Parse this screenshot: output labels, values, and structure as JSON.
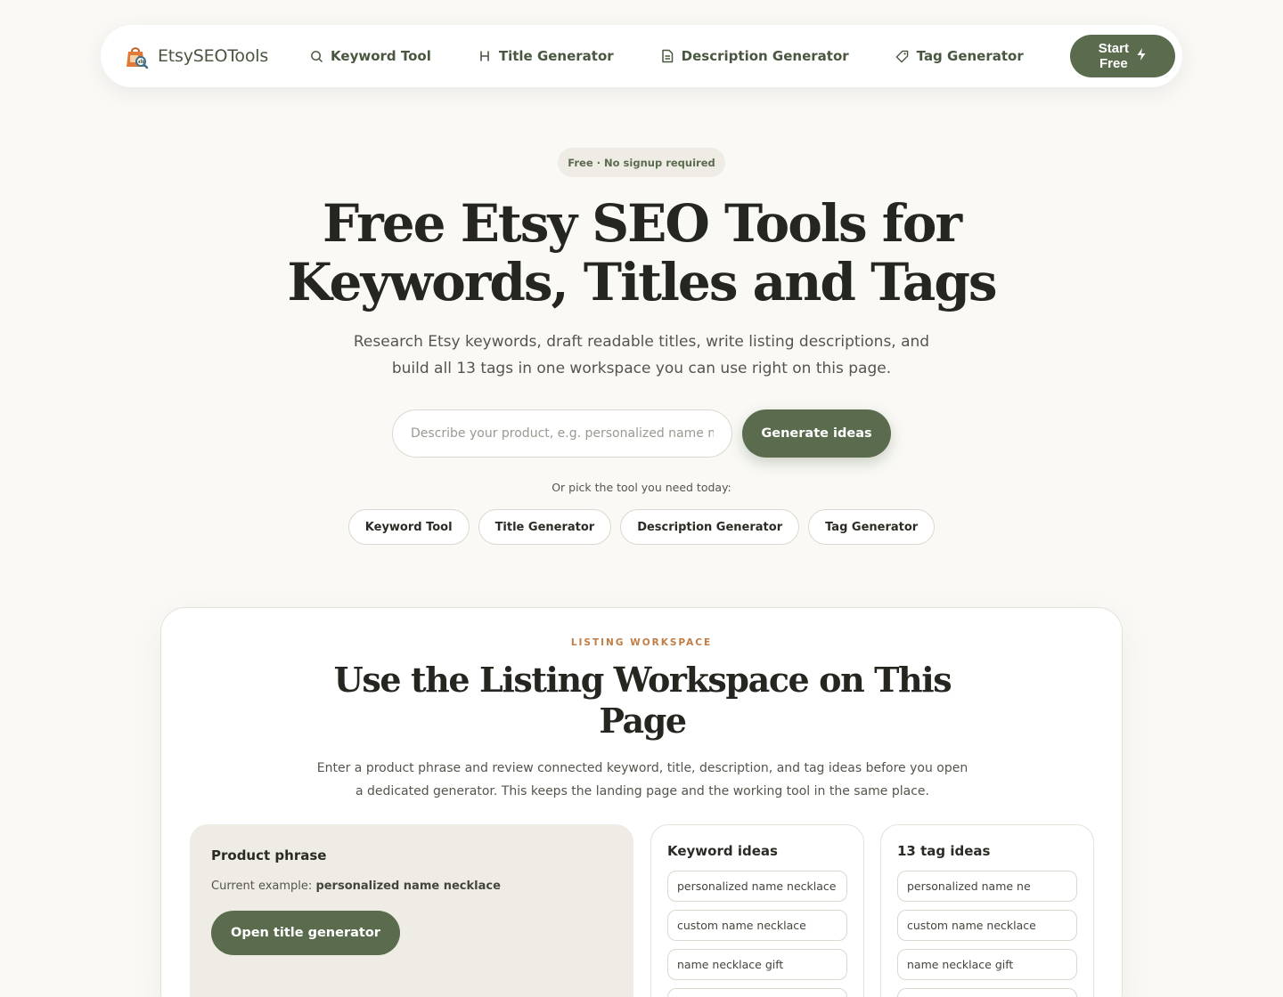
{
  "nav": {
    "brand": "EtsySEOTools",
    "links": [
      {
        "label": "Keyword Tool",
        "icon": "search-icon"
      },
      {
        "label": "Title Generator",
        "icon": "heading-icon"
      },
      {
        "label": "Description Generator",
        "icon": "document-icon"
      },
      {
        "label": "Tag Generator",
        "icon": "tag-icon"
      }
    ],
    "cta": "Start Free"
  },
  "hero": {
    "badge": "Free · No signup required",
    "title_line1": "Free Etsy SEO Tools for",
    "title_line2": "Keywords, Titles and Tags",
    "subtitle_line1": "Research Etsy keywords, draft readable titles, write listing descriptions, and",
    "subtitle_line2": "build all 13 tags in one workspace you can use right on this page.",
    "search_placeholder": "Describe your product, e.g. personalized name necklace",
    "generate_label": "Generate ideas",
    "pick_label": "Or pick the tool you need today:",
    "chips": [
      "Keyword Tool",
      "Title Generator",
      "Description Generator",
      "Tag Generator"
    ]
  },
  "workspace": {
    "eyebrow": "LISTING WORKSPACE",
    "title_line1": "Use the Listing Workspace on This",
    "title_line2": "Page",
    "subtitle_line1": "Enter a product phrase and review connected keyword, title, description, and tag ideas before you open",
    "subtitle_line2": "a dedicated generator. This keeps the landing page and the working tool in the same place.",
    "phrase": {
      "heading": "Product phrase",
      "current_prefix": "Current example:",
      "current_value": "personalized name necklace",
      "button": "Open title generator"
    },
    "keywords": {
      "heading": "Keyword ideas",
      "items": [
        "personalized name necklace",
        "custom name necklace",
        "name necklace gift",
        ""
      ]
    },
    "tags": {
      "heading": "13 tag ideas",
      "items": [
        "personalized name ne",
        "custom name necklace",
        "name necklace gift",
        ""
      ]
    }
  },
  "colors": {
    "accent": "#5b6b4e",
    "eyebrow": "#c07d45",
    "background": "#faf9f6"
  }
}
